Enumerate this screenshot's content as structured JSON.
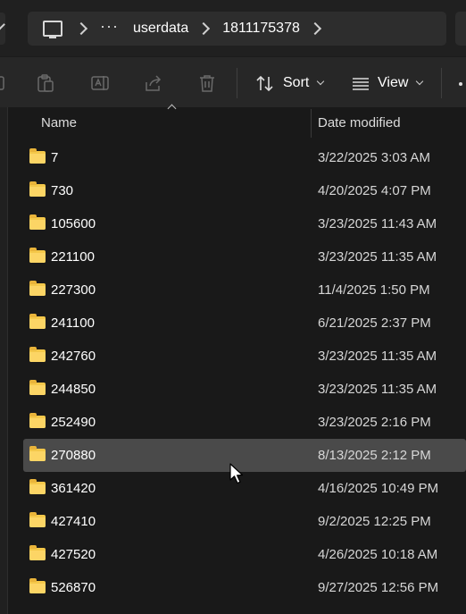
{
  "address_bar": {
    "breadcrumbs": [
      "userdata",
      "1811175378"
    ],
    "overflow_label": "···"
  },
  "toolbar": {
    "sort_label": "Sort",
    "view_label": "View"
  },
  "columns": {
    "name": "Name",
    "date_modified": "Date modified"
  },
  "files": [
    {
      "name": "7",
      "date": "3/22/2025 3:03 AM"
    },
    {
      "name": "730",
      "date": "4/20/2025 4:07 PM"
    },
    {
      "name": "105600",
      "date": "3/23/2025 11:43 AM"
    },
    {
      "name": "221100",
      "date": "3/23/2025 11:35 AM"
    },
    {
      "name": "227300",
      "date": "11/4/2025 1:50 PM"
    },
    {
      "name": "241100",
      "date": "6/21/2025 2:37 PM"
    },
    {
      "name": "242760",
      "date": "3/23/2025 11:35 AM"
    },
    {
      "name": "244850",
      "date": "3/23/2025 11:35 AM"
    },
    {
      "name": "252490",
      "date": "3/23/2025 2:16 PM"
    },
    {
      "name": "270880",
      "date": "8/13/2025 2:12 PM"
    },
    {
      "name": "361420",
      "date": "4/16/2025 10:49 PM"
    },
    {
      "name": "427410",
      "date": "9/2/2025 12:25 PM"
    },
    {
      "name": "427520",
      "date": "4/26/2025 10:18 AM"
    },
    {
      "name": "526870",
      "date": "9/27/2025 12:56 PM"
    }
  ],
  "selected_index": 9,
  "colors": {
    "background": "#191919",
    "selected_row": "#4a4a4a",
    "folder": "#f4c84a"
  }
}
